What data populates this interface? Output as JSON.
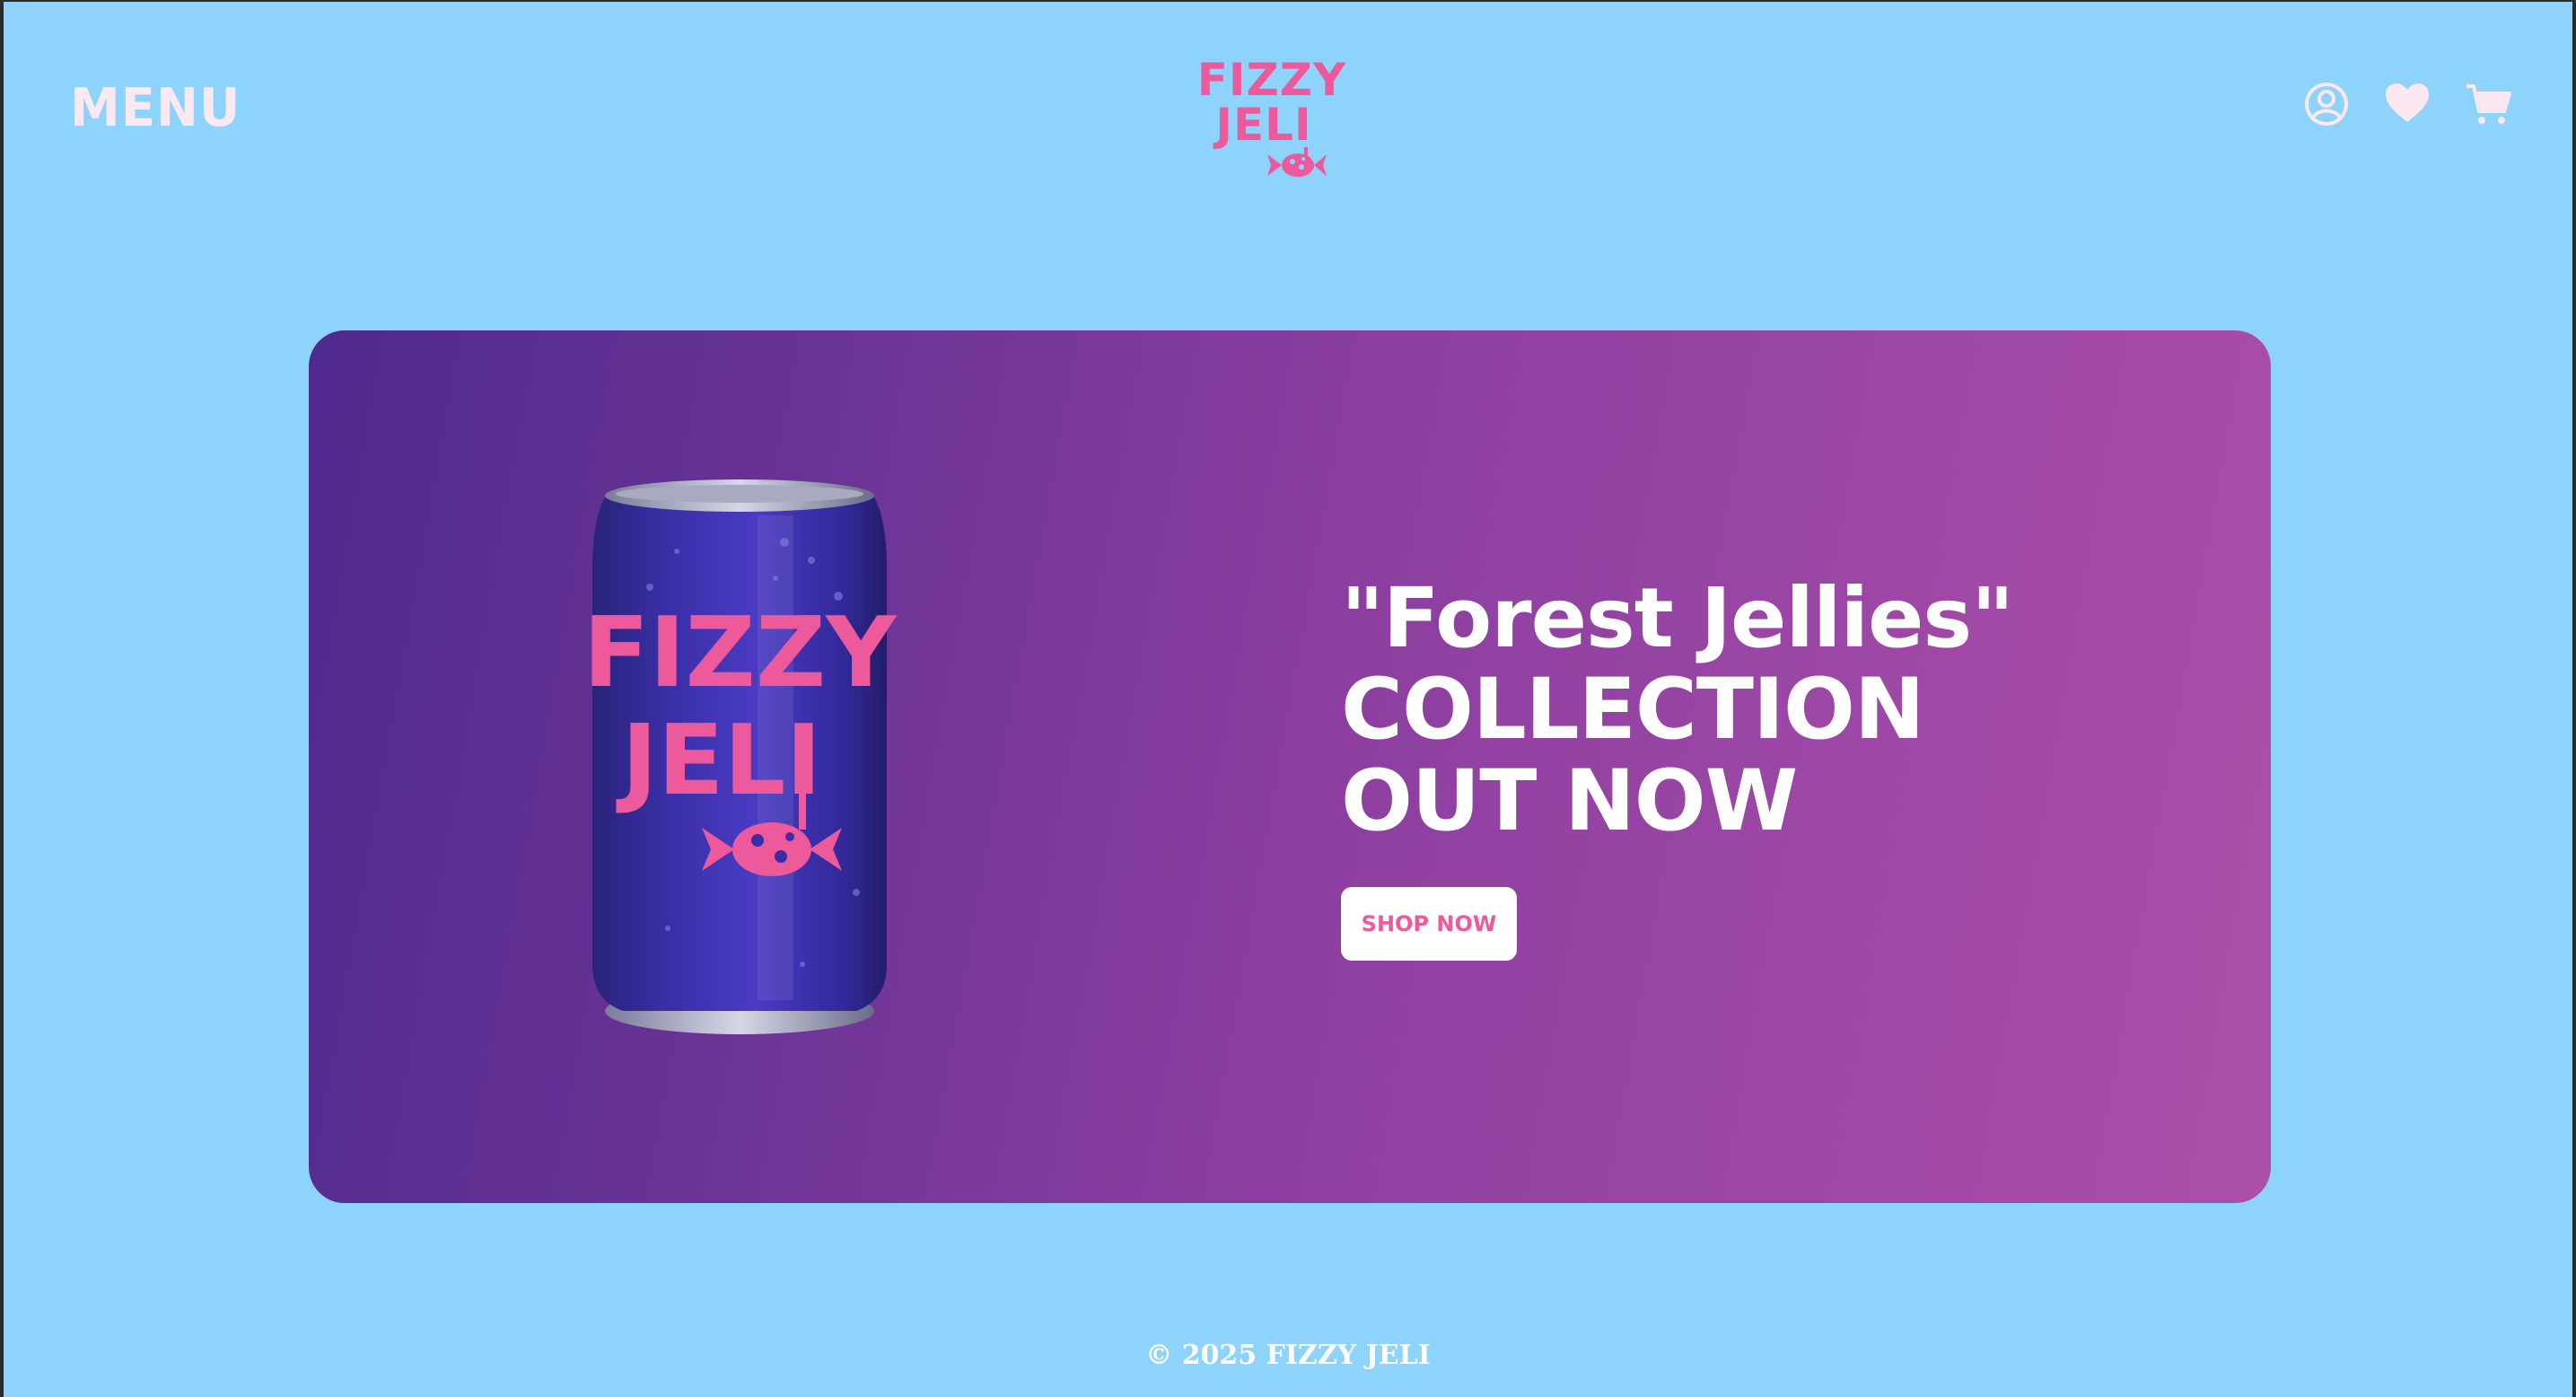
{
  "header": {
    "menu_label": "MENU",
    "logo": {
      "line1": "FIZZY",
      "line2": "JELI"
    },
    "icons": [
      "account-icon",
      "heart-icon",
      "cart-icon"
    ]
  },
  "hero": {
    "can_text": {
      "line1": "FIZZY",
      "line2": "JELI"
    },
    "heading": {
      "line1": "\"Forest Jellies\"",
      "line2": "COLLECTION",
      "line3": "OUT NOW"
    },
    "cta_label": "SHOP NOW"
  },
  "footer": {
    "copyright": "© 2025 FIZZY JELI"
  },
  "colors": {
    "page_bg": "#8dd3fb",
    "brand_pink": "#ec5a9c",
    "menu_text": "#fbe8f1",
    "hero_gradient_start": "#4f2a8d",
    "hero_gradient_end": "#ac4fa7",
    "can_body": "#3a2ea6"
  }
}
